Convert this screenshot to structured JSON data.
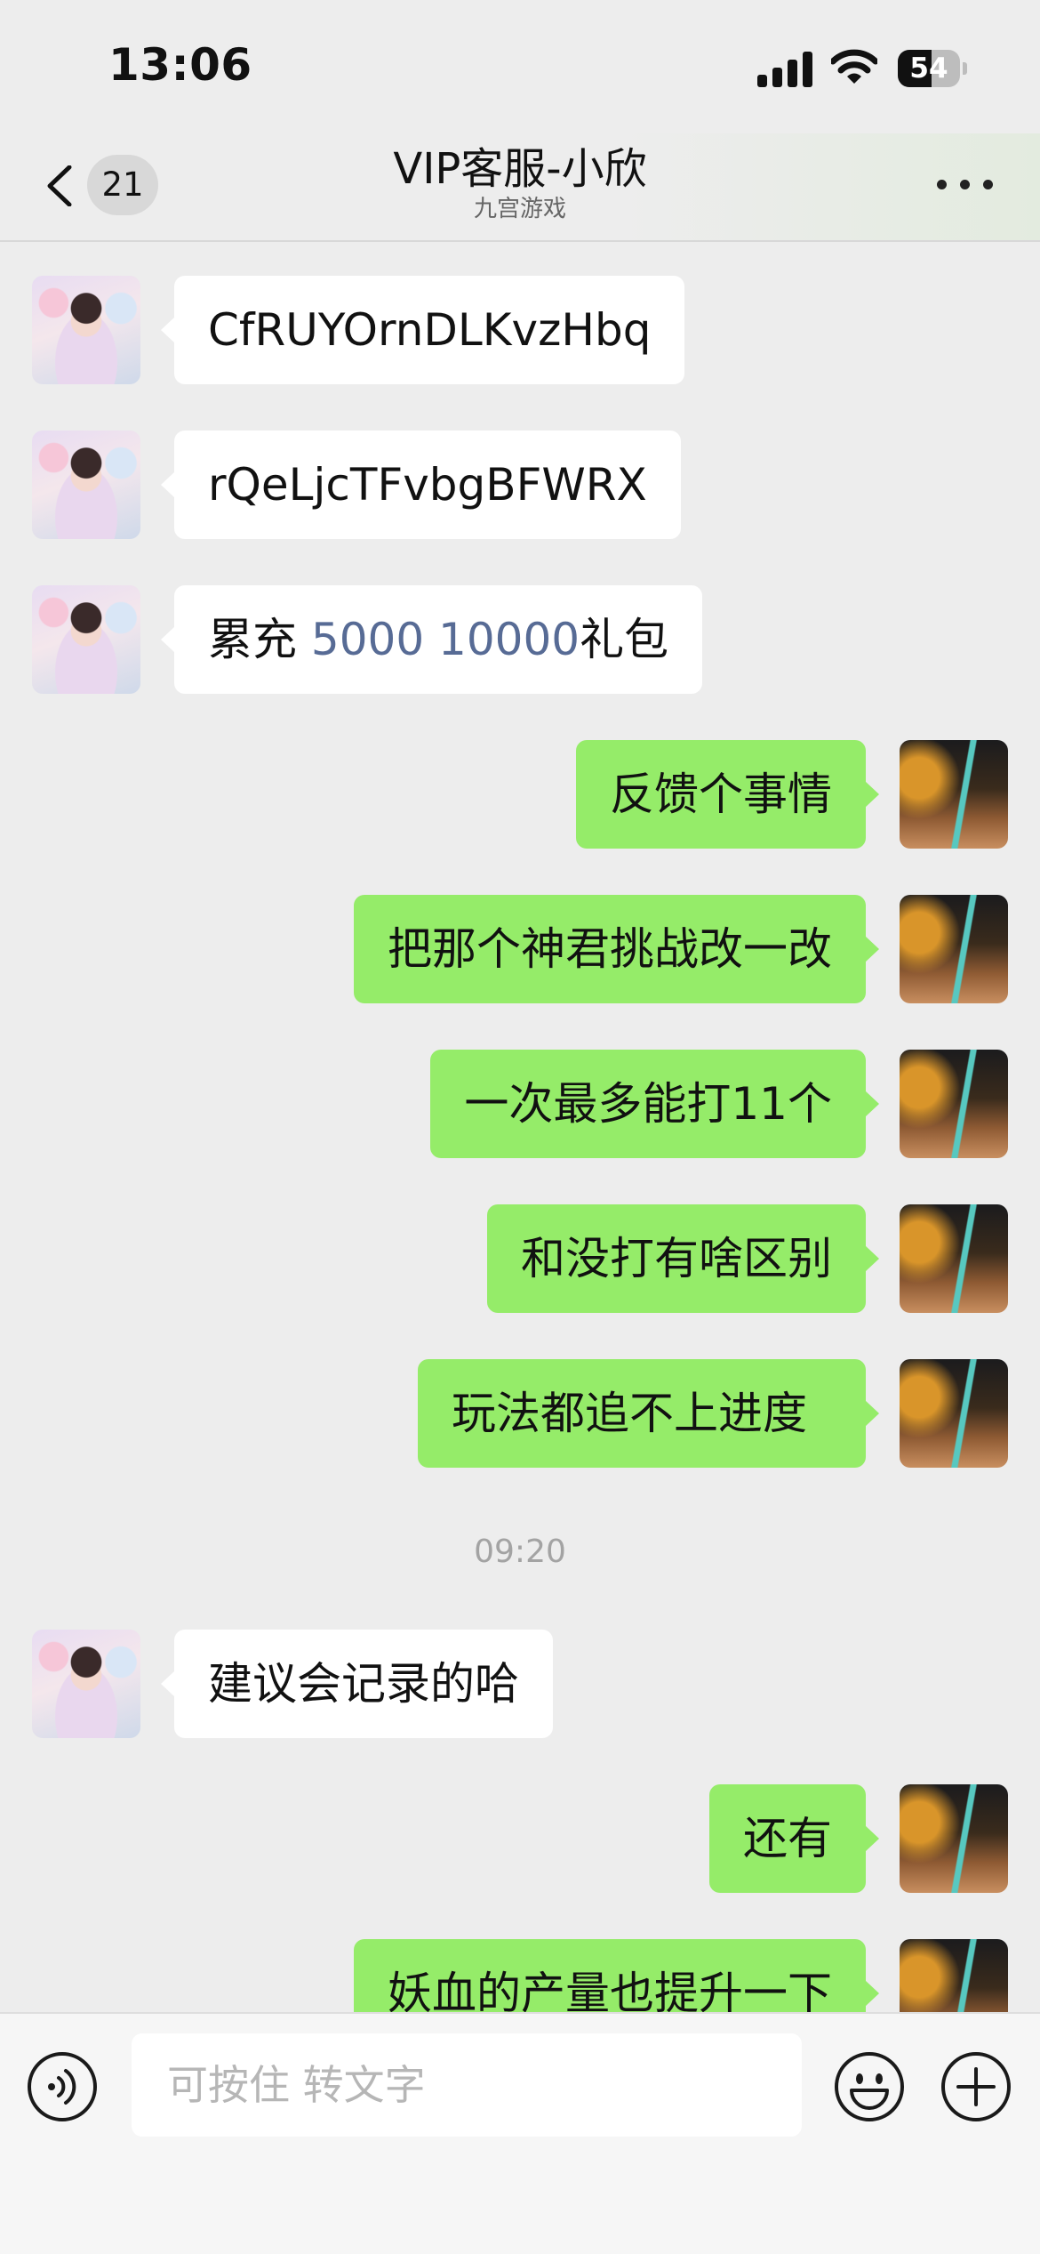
{
  "status_bar": {
    "time": "13:06",
    "battery_level": "54",
    "icons": [
      "cellular-signal-icon",
      "wifi-icon",
      "battery-icon"
    ]
  },
  "nav": {
    "back_icon": "chevron-left-icon",
    "unread_count": "21",
    "title": "VIP客服-小欣",
    "subtitle": "九宫游戏",
    "more_icon": "more-dots-icon"
  },
  "messages": [
    {
      "side": "left",
      "text": "CfRUYOrnDLKvzHbq"
    },
    {
      "side": "left",
      "text": "rQeLjcTFvbgBFWRX"
    },
    {
      "side": "left",
      "prefix": "累充 ",
      "highlight": "5000 10000",
      "suffix": "礼包"
    },
    {
      "side": "right",
      "text": "反馈个事情"
    },
    {
      "side": "right",
      "text": "把那个神君挑战改一改"
    },
    {
      "side": "right",
      "text": "一次最多能打11个"
    },
    {
      "side": "right",
      "text": "和没打有啥区别"
    },
    {
      "side": "right",
      "text": "玩法都追不上进度"
    },
    {
      "side": "left",
      "text": "建议会记录的哈"
    },
    {
      "side": "right",
      "text": "还有"
    },
    {
      "side": "right",
      "text": "妖血的产量也提升一下"
    }
  ],
  "timestamp": "09:20",
  "input_bar": {
    "placeholder": "可按住 转文字",
    "voice_icon": "voice-icon",
    "emoji_icon": "emoji-icon",
    "plus_icon": "plus-icon"
  },
  "colors": {
    "background": "#ededed",
    "bubble_self": "#95ec69",
    "bubble_other": "#ffffff",
    "link": "#576b95"
  }
}
